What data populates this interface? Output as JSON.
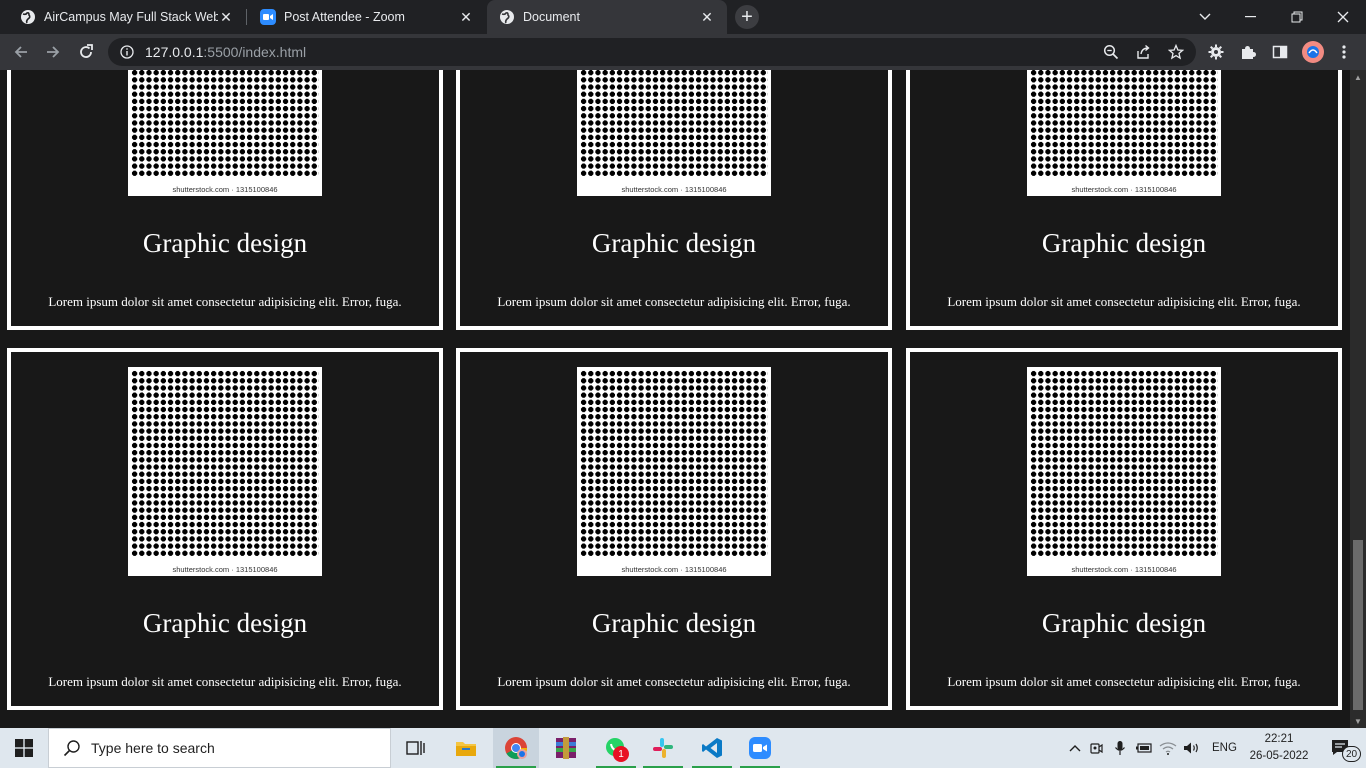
{
  "browser": {
    "tabs": [
      {
        "title": "AirCampus May Full Stack Web D",
        "favicon": "globe-icon",
        "active": false
      },
      {
        "title": "Post Attendee - Zoom",
        "favicon": "zoom-icon",
        "active": false
      },
      {
        "title": "Document",
        "favicon": "globe-icon",
        "active": true
      }
    ],
    "url_host": "127.0.0.1",
    "url_rest": ":5500/index.html"
  },
  "page": {
    "cards": [
      {
        "title": "Graphic design",
        "text": "Lorem ipsum dolor sit amet consectetur adipisicing elit. Error, fuga.",
        "image_caption": "shutterstock.com · 1315100846"
      },
      {
        "title": "Graphic design",
        "text": "Lorem ipsum dolor sit amet consectetur adipisicing elit. Error, fuga.",
        "image_caption": "shutterstock.com · 1315100846"
      },
      {
        "title": "Graphic design",
        "text": "Lorem ipsum dolor sit amet consectetur adipisicing elit. Error, fuga.",
        "image_caption": "shutterstock.com · 1315100846"
      },
      {
        "title": "Graphic design",
        "text": "Lorem ipsum dolor sit amet consectetur adipisicing elit. Error, fuga.",
        "image_caption": "shutterstock.com · 1315100846"
      },
      {
        "title": "Graphic design",
        "text": "Lorem ipsum dolor sit amet consectetur adipisicing elit. Error, fuga.",
        "image_caption": "shutterstock.com · 1315100846"
      },
      {
        "title": "Graphic design",
        "text": "Lorem ipsum dolor sit amet consectetur adipisicing elit. Error, fuga.",
        "image_caption": "shutterstock.com · 1315100846"
      }
    ]
  },
  "taskbar": {
    "search_placeholder": "Type here to search",
    "whatsapp_badge": "1",
    "language": "ENG",
    "time": "22:21",
    "date": "26-05-2022",
    "notification_count": "20"
  },
  "colors": {
    "page_bg": "#181818",
    "card_border": "#ffffff",
    "chrome_dark": "#202124",
    "toolbar": "#35363a",
    "taskbar": "#dfe7ee"
  }
}
